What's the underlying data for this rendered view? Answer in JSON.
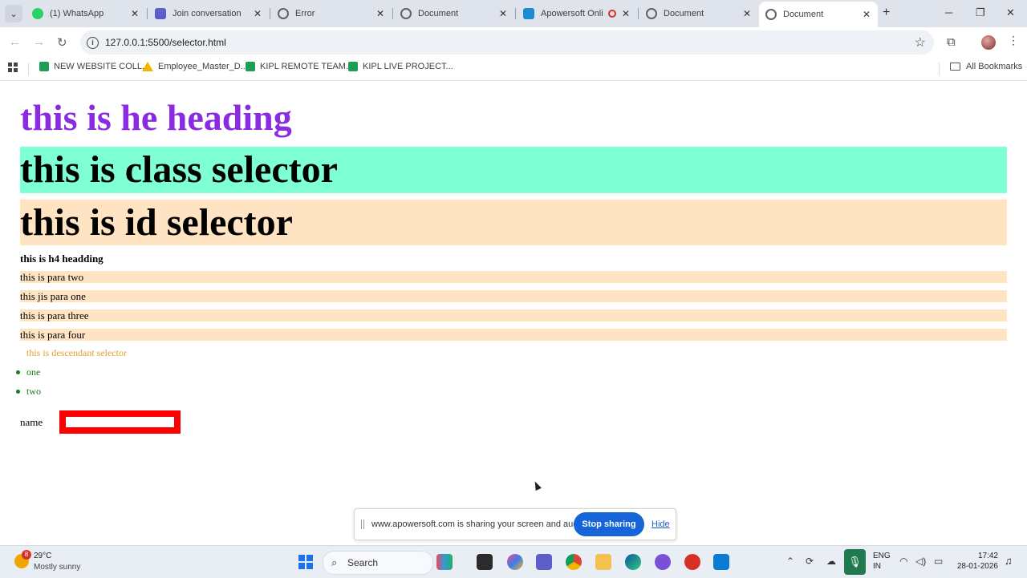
{
  "tabs": [
    {
      "title": "(1) WhatsApp",
      "icon": "whatsapp-icon",
      "color": "#25d366"
    },
    {
      "title": "Join conversation",
      "icon": "teams-icon",
      "color": "#5b5fc7"
    },
    {
      "title": "Error",
      "icon": "globe-icon",
      "color": "#5f6368"
    },
    {
      "title": "Document",
      "icon": "globe-icon",
      "color": "#5f6368"
    },
    {
      "title": "Apowersoft Onli",
      "icon": "apowersoft-icon",
      "color": "#1a8ccf"
    },
    {
      "title": "Document",
      "icon": "globe-icon",
      "color": "#5f6368"
    },
    {
      "title": "Document",
      "icon": "globe-icon",
      "color": "#5f6368"
    }
  ],
  "active_tab_index": 6,
  "address_bar": {
    "url": "127.0.0.1:5500/selector.html"
  },
  "bookmarks": [
    {
      "label": "NEW WEBSITE COLL...",
      "icon": "sheets-icon"
    },
    {
      "label": "Employee_Master_D...",
      "icon": "drive-icon"
    },
    {
      "label": "KIPL REMOTE TEAM...",
      "icon": "sheets-icon"
    },
    {
      "label": "KIPL LIVE PROJECT...",
      "icon": "sheets-icon"
    }
  ],
  "all_bookmarks_label": "All Bookmarks",
  "page": {
    "heading": "this is he heading",
    "class_selector": "this is class selector",
    "id_selector": "this is id selector",
    "h4": "this is h4 headding",
    "paras": [
      "this is para two",
      "this jis para one",
      "this is para three",
      "this is para four"
    ],
    "descendant": "this is descendant selector",
    "list_items": [
      "one",
      "two"
    ],
    "name_label": "name",
    "name_value": ""
  },
  "share_bar": {
    "message": "www.apowersoft.com is sharing your screen and audio.",
    "stop_label": "Stop sharing",
    "hide_label": "Hide"
  },
  "taskbar": {
    "weather_badge": "8",
    "temperature": "29°C",
    "weather_desc": "Mostly sunny",
    "search_label": "Search",
    "lang_line1": "ENG",
    "lang_line2": "IN",
    "time": "17:42",
    "date": "28-01-2026"
  },
  "colors": {
    "heading": "#8a2be2",
    "class_bg": "#7fffd4",
    "id_bg": "#ffe4c4",
    "descendant": "#e0a030",
    "list": "#1a7a1a",
    "input_border": "#ff0000"
  }
}
